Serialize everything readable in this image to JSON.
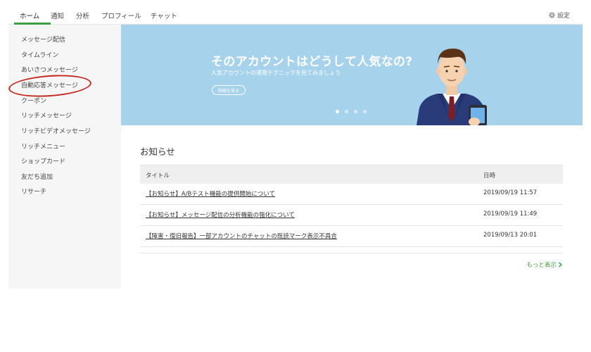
{
  "nav": {
    "tabs": [
      {
        "label": "ホーム"
      },
      {
        "label": "通知"
      },
      {
        "label": "分析"
      },
      {
        "label": "プロフィール"
      },
      {
        "label": "チャット"
      }
    ],
    "settings_label": "設定",
    "settings_icon": "gear-icon",
    "accent_color": "#3c9e3c"
  },
  "sidebar": {
    "items": [
      {
        "label": "メッセージ配信"
      },
      {
        "label": "タイムライン"
      },
      {
        "label": "あいさつメッセージ"
      },
      {
        "label": "自動応答メッセージ"
      },
      {
        "label": "クーポン"
      },
      {
        "label": "リッチメッセージ"
      },
      {
        "label": "リッチビデオメッセージ"
      },
      {
        "label": "リッチメニュー"
      },
      {
        "label": "ショップカード"
      },
      {
        "label": "友だち追加"
      },
      {
        "label": "リサーチ"
      }
    ],
    "highlight_color": "#c32a22"
  },
  "banner": {
    "headline": "そのアカウントはどうして人気なの?",
    "subtext": "人気アカウントの運用テクニックを見てみましょう",
    "button_label": "詳細を見る",
    "background": "#a7d2ec",
    "dots": 4,
    "active_dot": 1
  },
  "notices": {
    "title": "お知らせ",
    "columns": {
      "title": "タイトル",
      "date": "日時"
    },
    "rows": [
      {
        "title": "【お知らせ】A/Bテスト機能の提供開始について",
        "date": "2019/09/19 11:57"
      },
      {
        "title": "【お知らせ】メッセージ配信の分析機能の強化について",
        "date": "2019/09/19 11:49"
      },
      {
        "title": "【障害・復旧報告】一部アカウントのチャットの既読マーク表示不具合",
        "date": "2019/09/13 20:01"
      }
    ],
    "more_label": "もっと表示"
  }
}
